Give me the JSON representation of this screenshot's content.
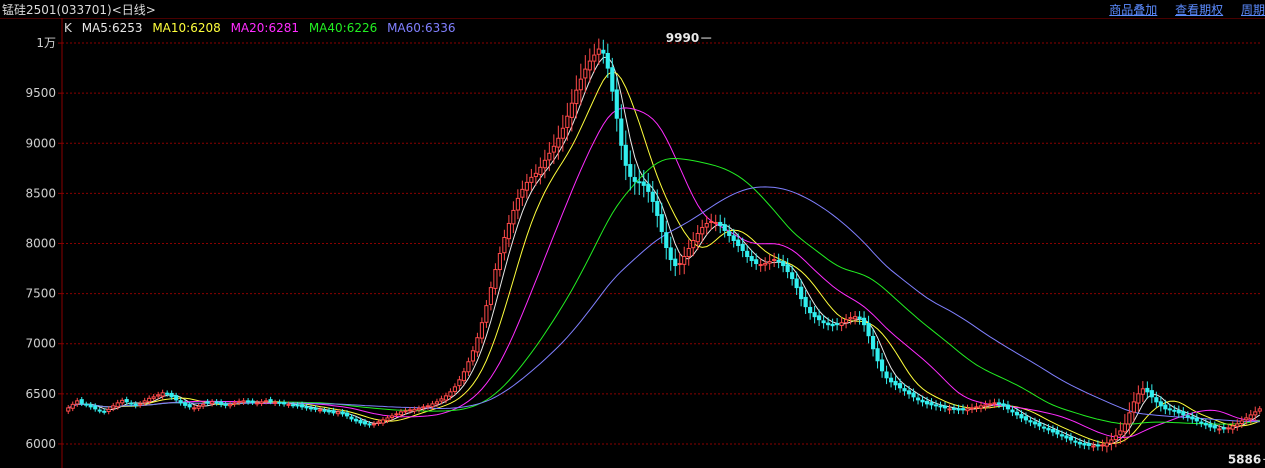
{
  "window": {
    "title": "锰硅2501(033701)<日线>",
    "links": [
      "商品叠加",
      "查看期权",
      "周期"
    ]
  },
  "legend": {
    "k_label": "K",
    "items": [
      {
        "text": "MA5:6253",
        "color": "#e8e8e8"
      },
      {
        "text": "MA10:6208",
        "color": "#ffff3c"
      },
      {
        "text": "MA20:6281",
        "color": "#ff2cff"
      },
      {
        "text": "MA40:6226",
        "color": "#22ee22"
      },
      {
        "text": "MA60:6336",
        "color": "#8080ff"
      }
    ]
  },
  "colors": {
    "up": "#ff4a4a",
    "down": "#33eeee",
    "grid": "#8a0000",
    "axis": "#8a0000"
  },
  "chart_data": {
    "type": "candlestick",
    "y_tick_labels": [
      "1万",
      "9500",
      "9000",
      "8500",
      "8000",
      "7500",
      "7000",
      "6500",
      "6000"
    ],
    "y_tick_values": [
      10000,
      9500,
      9000,
      8500,
      8000,
      7500,
      7000,
      6500,
      6000
    ],
    "ylim": [
      5760,
      10250
    ],
    "annotations": [
      {
        "text": "9990",
        "value": 9990,
        "index": 143
      },
      {
        "text": "5886",
        "value": 5886,
        "index": 268
      }
    ],
    "ma_last_values": {
      "MA5": 6253,
      "MA10": 6208,
      "MA20": 6281,
      "MA40": 6226,
      "MA60": 6336
    },
    "closes": [
      6360,
      6395,
      6430,
      6405,
      6390,
      6370,
      6350,
      6330,
      6320,
      6345,
      6380,
      6410,
      6435,
      6420,
      6400,
      6385,
      6400,
      6430,
      6455,
      6470,
      6490,
      6510,
      6500,
      6470,
      6440,
      6410,
      6385,
      6370,
      6360,
      6375,
      6395,
      6410,
      6420,
      6410,
      6395,
      6385,
      6395,
      6410,
      6425,
      6430,
      6420,
      6415,
      6410,
      6420,
      6430,
      6425,
      6415,
      6405,
      6400,
      6395,
      6385,
      6380,
      6370,
      6360,
      6350,
      6345,
      6340,
      6330,
      6320,
      6310,
      6320,
      6300,
      6280,
      6250,
      6230,
      6210,
      6200,
      6190,
      6200,
      6220,
      6240,
      6260,
      6280,
      6300,
      6320,
      6330,
      6340,
      6345,
      6355,
      6370,
      6380,
      6400,
      6420,
      6450,
      6480,
      6520,
      6570,
      6640,
      6720,
      6820,
      6930,
      7060,
      7210,
      7380,
      7560,
      7740,
      7900,
      8060,
      8200,
      8330,
      8450,
      8540,
      8610,
      8660,
      8700,
      8760,
      8830,
      8900,
      8970,
      9050,
      9150,
      9270,
      9400,
      9530,
      9640,
      9740,
      9820,
      9880,
      9940,
      9900,
      9750,
      9520,
      9250,
      8980,
      8780,
      8670,
      8620,
      8610,
      8580,
      8520,
      8420,
      8280,
      8120,
      7960,
      7840,
      7780,
      7800,
      7870,
      7950,
      8030,
      8100,
      8160,
      8200,
      8220,
      8210,
      8180,
      8130,
      8080,
      8030,
      7980,
      7930,
      7870,
      7830,
      7800,
      7790,
      7800,
      7820,
      7840,
      7820,
      7780,
      7720,
      7650,
      7560,
      7450,
      7370,
      7310,
      7270,
      7240,
      7210,
      7190,
      7180,
      7190,
      7210,
      7240,
      7260,
      7270,
      7250,
      7190,
      7080,
      6950,
      6830,
      6730,
      6660,
      6620,
      6590,
      6560,
      6530,
      6500,
      6470,
      6440,
      6420,
      6400,
      6390,
      6380,
      6370,
      6360,
      6350,
      6345,
      6340,
      6340,
      6350,
      6360,
      6370,
      6380,
      6390,
      6400,
      6410,
      6400,
      6380,
      6350,
      6320,
      6290,
      6260,
      6240,
      6220,
      6200,
      6180,
      6160,
      6140,
      6120,
      6100,
      6080,
      6060,
      6040,
      6020,
      6000,
      5990,
      5985,
      5980,
      5980,
      5990,
      6010,
      6040,
      6080,
      6130,
      6200,
      6310,
      6420,
      6500,
      6550,
      6520,
      6470,
      6420,
      6380,
      6350,
      6340,
      6330,
      6310,
      6290,
      6270,
      6250,
      6230,
      6210,
      6190,
      6170,
      6160,
      6150,
      6150,
      6160,
      6180,
      6200,
      6230,
      6260,
      6290,
      6320,
      6350
    ],
    "hl_spread": [
      80,
      80,
      85,
      75,
      70,
      80,
      80,
      70,
      75,
      80,
      85,
      85,
      75,
      80,
      80,
      85,
      80,
      85,
      85,
      80,
      85,
      90,
      80,
      85,
      80,
      80,
      85,
      80,
      80,
      80,
      85,
      80,
      80,
      80,
      80,
      85,
      80,
      80,
      80,
      80,
      80,
      75,
      80,
      80,
      80,
      80,
      75,
      80,
      80,
      80,
      80,
      80,
      85,
      80,
      80,
      80,
      80,
      75,
      80,
      80,
      80,
      80,
      85,
      80,
      80,
      80,
      80,
      80,
      80,
      80,
      80,
      80,
      80,
      80,
      80,
      85,
      80,
      80,
      80,
      80,
      80,
      85,
      90,
      90,
      90,
      100,
      100,
      110,
      110,
      120,
      130,
      140,
      150,
      160,
      170,
      180,
      200,
      220,
      240,
      260,
      260,
      250,
      240,
      240,
      260,
      280,
      300,
      320,
      340,
      360,
      380,
      380,
      400,
      420,
      440,
      400,
      360,
      320,
      300,
      300,
      280,
      280,
      380,
      420,
      420,
      400,
      380,
      360,
      340,
      320,
      320,
      340,
      340,
      340,
      320,
      300,
      300,
      280,
      260,
      240,
      240,
      220,
      220,
      220,
      220,
      220,
      200,
      200,
      200,
      190,
      190,
      180,
      180,
      180,
      180,
      180,
      190,
      190,
      190,
      190,
      190,
      200,
      210,
      220,
      210,
      200,
      190,
      180,
      170,
      160,
      160,
      160,
      160,
      160,
      160,
      160,
      170,
      200,
      220,
      220,
      220,
      200,
      180,
      160,
      150,
      140,
      140,
      140,
      130,
      130,
      130,
      130,
      130,
      130,
      120,
      120,
      120,
      120,
      120,
      120,
      120,
      120,
      120,
      120,
      120,
      120,
      120,
      120,
      120,
      120,
      120,
      120,
      120,
      120,
      120,
      120,
      120,
      120,
      120,
      120,
      120,
      120,
      120,
      120,
      120,
      120,
      120,
      120,
      120,
      130,
      150,
      180,
      200,
      220,
      260,
      280,
      300,
      280,
      240,
      220,
      200,
      180,
      170,
      160,
      150,
      140,
      140,
      140,
      130,
      130,
      130,
      130,
      120,
      120,
      120,
      120,
      120,
      120,
      120,
      130,
      130,
      130,
      140,
      140,
      150
    ]
  }
}
